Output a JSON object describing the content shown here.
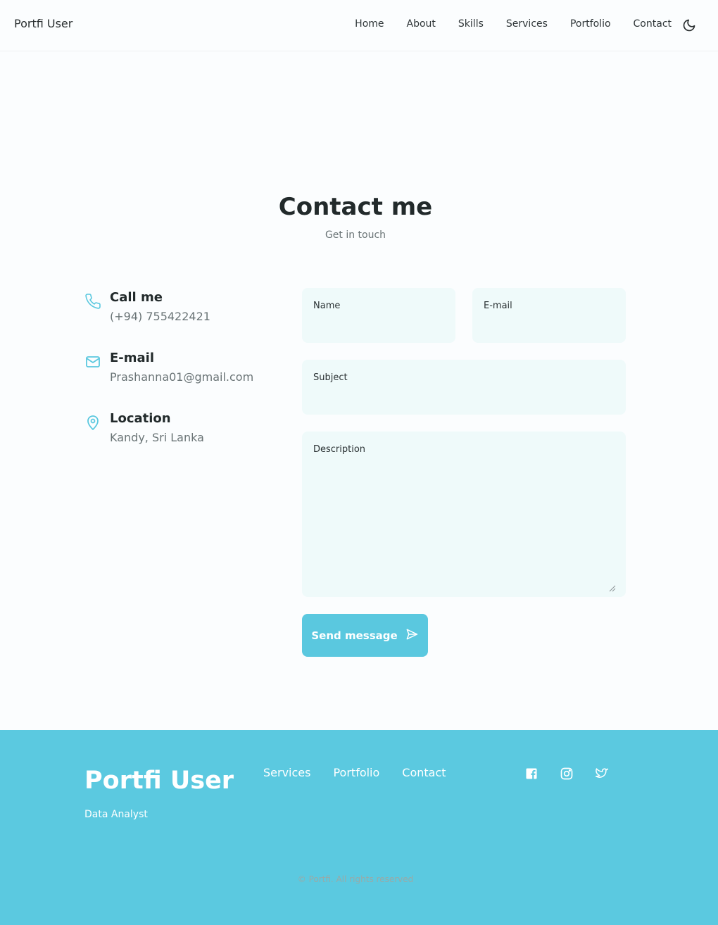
{
  "header": {
    "brand": "Portfi User",
    "nav": [
      "Home",
      "About",
      "Skills",
      "Services",
      "Portfolio",
      "Contact"
    ],
    "theme_icon": "moon-icon"
  },
  "contact": {
    "title": "Contact me",
    "subtitle": "Get in touch",
    "info": [
      {
        "icon": "phone-icon",
        "title": "Call me",
        "value": "(+94) 755422421"
      },
      {
        "icon": "mail-icon",
        "title": "E-mail",
        "value": "Prashanna01@gmail.com"
      },
      {
        "icon": "map-pin-icon",
        "title": "Location",
        "value": "Kandy, Sri Lanka"
      }
    ],
    "form": {
      "name_label": "Name",
      "name_value": "",
      "email_label": "E-mail",
      "email_value": "",
      "subject_label": "Subject",
      "subject_value": "",
      "description_label": "Description",
      "description_value": "",
      "send_label": "Send message",
      "send_icon": "send-icon"
    }
  },
  "footer": {
    "brand": "Portfi User",
    "role": "Data Analyst",
    "links": [
      "Services",
      "Portfolio",
      "Contact"
    ],
    "socials": [
      "facebook-icon",
      "instagram-icon",
      "twitter-icon"
    ],
    "copyright": "© Portfi. All rights reserved"
  },
  "colors": {
    "accent": "#5ac8df",
    "field_bg": "#effafa",
    "text_dark": "#222a2b",
    "text_muted": "#6a7476"
  }
}
